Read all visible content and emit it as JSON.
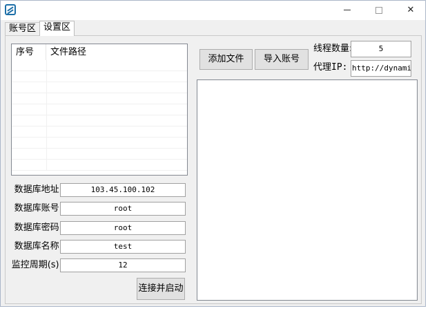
{
  "window": {
    "title": "",
    "close_glyph": "✕"
  },
  "tabs": [
    {
      "label": "账号区",
      "active": false
    },
    {
      "label": "设置区",
      "active": true
    }
  ],
  "file_list": {
    "columns": [
      "序号",
      "文件路径"
    ],
    "rows": []
  },
  "database": {
    "address_label": "数据库地址:",
    "address_value": "103.45.100.102",
    "account_label": "数据库账号:",
    "account_value": "root",
    "password_label": "数据库密码:",
    "password_value": "root",
    "name_label": "数据库名称:",
    "name_value": "test",
    "period_label": "监控周期(s):",
    "period_value": "12"
  },
  "buttons": {
    "add_file": "添加文件",
    "import_account": "导入账号",
    "connect_start": "连接并启动"
  },
  "settings": {
    "threads_label": "线程数量:",
    "threads_value": "5",
    "proxy_label": "代理IP:",
    "proxy_value": "http://dynamic."
  },
  "log": {
    "text": ""
  }
}
